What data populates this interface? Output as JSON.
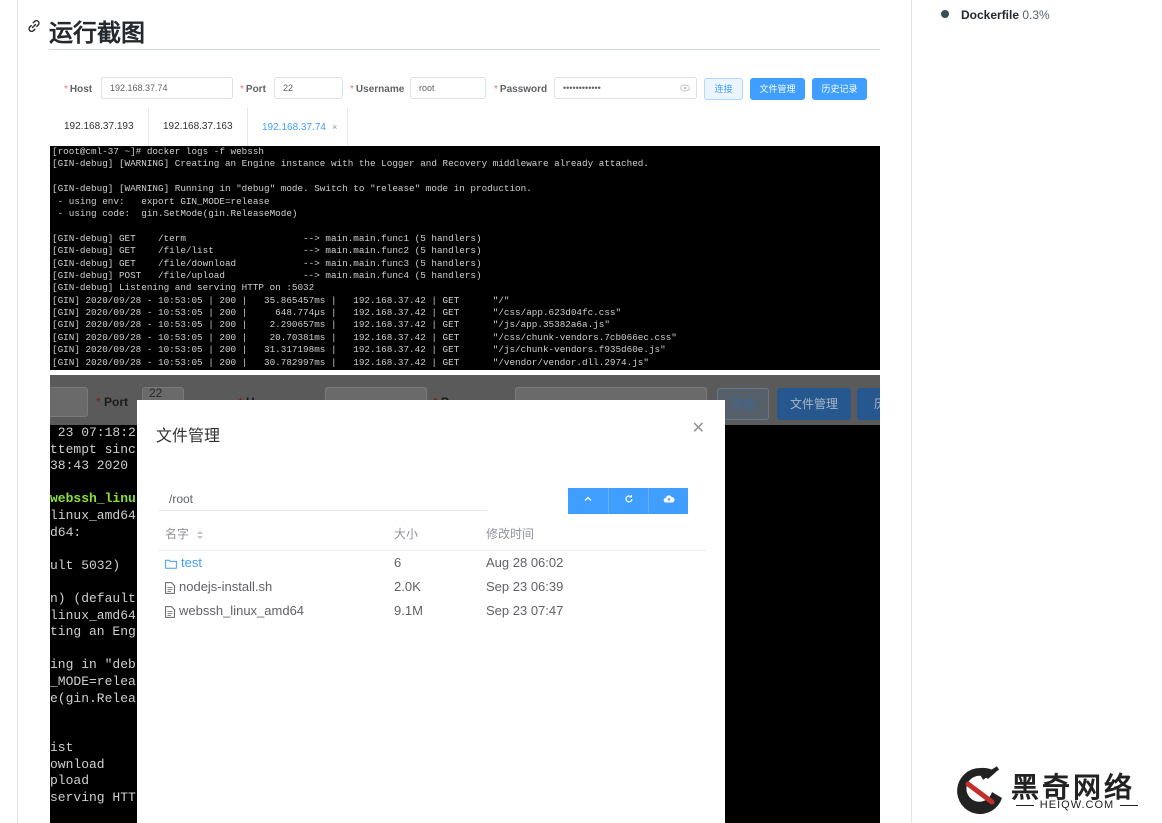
{
  "sidebar": {
    "language": {
      "name": "Dockerfile",
      "percent": "0.3%",
      "color": "#384d54"
    }
  },
  "section": {
    "title": "运行截图"
  },
  "shot1": {
    "form": {
      "host_label": "Host",
      "host_value": "192.168.37.74",
      "port_label": "Port",
      "port_value": "22",
      "username_label": "Username",
      "username_value": "root",
      "password_label": "Password",
      "password_value": "••••••••••••",
      "connect_label": "连接",
      "files_label": "文件管理",
      "history_label": "历史记录"
    },
    "tabs": [
      "192.168.37.193",
      "192.168.37.163",
      "192.168.37.74"
    ],
    "active_tab": 2,
    "terminal": [
      "[root@cml-37 ~]# docker logs -f webssh",
      "[GIN-debug] [WARNING] Creating an Engine instance with the Logger and Recovery middleware already attached.",
      "",
      "[GIN-debug] [WARNING] Running in \"debug\" mode. Switch to \"release\" mode in production.",
      " - using env:   export GIN_MODE=release",
      " - using code:  gin.SetMode(gin.ReleaseMode)",
      "",
      "[GIN-debug] GET    /term                     --> main.main.func1 (5 handlers)",
      "[GIN-debug] GET    /file/list                --> main.main.func2 (5 handlers)",
      "[GIN-debug] GET    /file/download            --> main.main.func3 (5 handlers)",
      "[GIN-debug] POST   /file/upload              --> main.main.func4 (5 handlers)",
      "[GIN-debug] Listening and serving HTTP on :5032",
      "[GIN] 2020/09/28 - 10:53:05 | 200 |   35.865457ms |   192.168.37.42 | GET      \"/\"",
      "[GIN] 2020/09/28 - 10:53:05 | 200 |     648.774µs |   192.168.37.42 | GET      \"/css/app.623d04fc.css\"",
      "[GIN] 2020/09/28 - 10:53:05 | 200 |    2.290657ms |   192.168.37.42 | GET      \"/js/app.35382a6a.js\"",
      "[GIN] 2020/09/28 - 10:53:05 | 200 |    20.70381ms |   192.168.37.42 | GET      \"/css/chunk-vendors.7cb066ec.css\"",
      "[GIN] 2020/09/28 - 10:53:05 | 200 |   31.317198ms |   192.168.37.42 | GET      \"/js/chunk-vendors.f935d60e.js\"",
      "[GIN] 2020/09/28 - 10:53:05 | 200 |   30.782997ms |   192.168.37.42 | GET      \"/vendor/vendor.dll.2974.js\""
    ]
  },
  "shot2": {
    "bg_form": {
      "port_label": "Port",
      "port_value": "22",
      "username_fragment": "U",
      "password_fragment": "P",
      "connect_label": "连接",
      "files_label": "文件管理",
      "history_fragment": "历"
    },
    "bg_terminal": [
      " 23 07:18:2",
      "ttempt sinc",
      "38:43 2020",
      "",
      "webssh_linu",
      "linux_amd64",
      "d64:",
      "",
      "ult 5032)",
      "",
      "n) (default",
      "linux_amd64",
      "ting an Eng",
      "",
      "ing in \"deb",
      "_MODE=relea",
      "e(gin.Relea",
      "",
      "",
      "ist",
      "ownload",
      "pload",
      "serving HTT"
    ],
    "modal": {
      "title": "文件管理",
      "path": "/root",
      "columns": {
        "name": "名字",
        "size": "大小",
        "modified": "修改时间"
      },
      "files": [
        {
          "name": "test",
          "size": "6",
          "modified": "Aug 28 06:02",
          "is_dir": true
        },
        {
          "name": "nodejs-install.sh",
          "size": "2.0K",
          "modified": "Sep 23 06:39",
          "is_dir": false
        },
        {
          "name": "webssh_linux_amd64",
          "size": "9.1M",
          "modified": "Sep 23 07:47",
          "is_dir": false
        }
      ]
    }
  },
  "watermark": {
    "name": "黑奇网络",
    "url": "HEIQW.COM"
  }
}
